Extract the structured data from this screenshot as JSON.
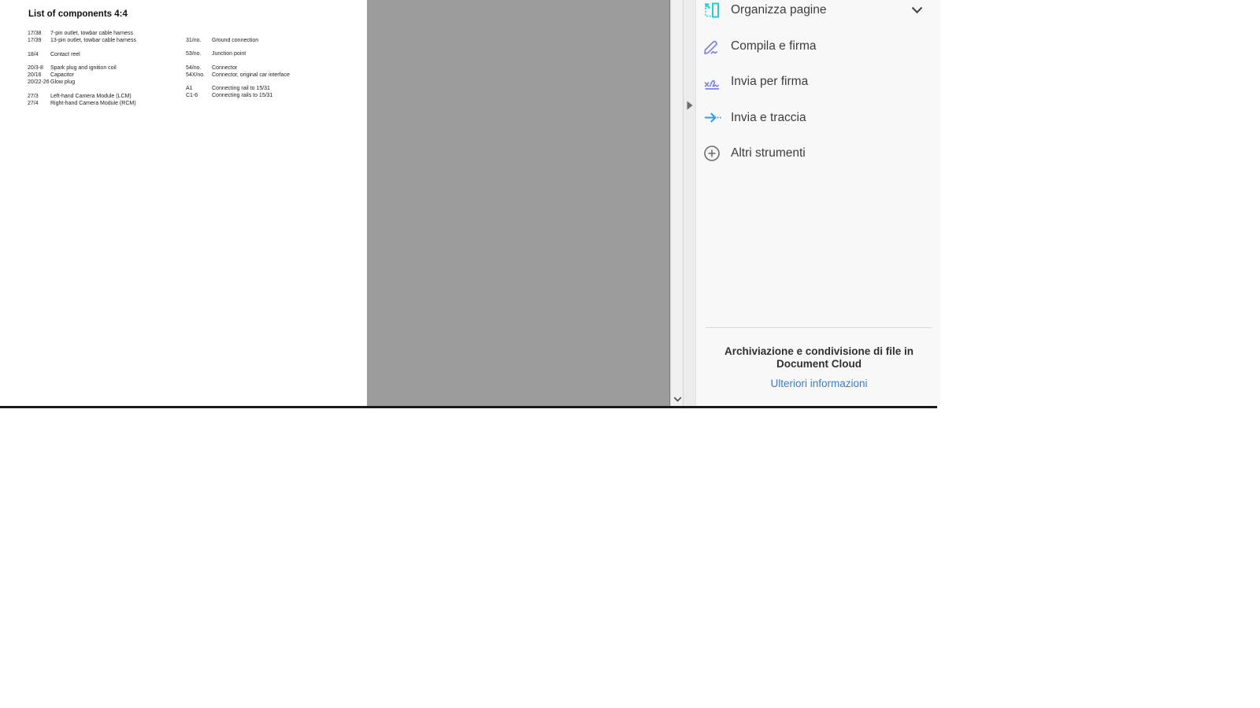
{
  "pdf_page": {
    "title": "List of components 4:4",
    "columns": [
      {
        "groups": [
          [
            {
              "code": "17/38",
              "desc": "7-pin outlet, towbar cable harness"
            },
            {
              "code": "17/39",
              "desc": "13-pin outlet, towbar cable harness"
            }
          ],
          [
            {
              "code": "18/4",
              "desc": "Contact reel"
            }
          ],
          [
            {
              "code": "20/3-8",
              "desc": "Spark plug and ignition coil"
            },
            {
              "code": "20/16",
              "desc": "Capacitor"
            },
            {
              "code": "20/22-26",
              "desc": "Glow plug"
            }
          ],
          [
            {
              "code": "27/3",
              "desc": "Left-hand Camera Module (LCM)"
            },
            {
              "code": "27/4",
              "desc": "Right-hand Camera Module (RCM)"
            }
          ]
        ]
      },
      {
        "groups": [
          [
            {
              "code": "31/no.",
              "desc": "Ground connection"
            }
          ],
          [
            {
              "code": "53/no.",
              "desc": "Junction point"
            }
          ],
          [
            {
              "code": "54/no.",
              "desc": "Connector"
            },
            {
              "code": "54X/no.",
              "desc": "Connector, original car interface"
            }
          ],
          [
            {
              "code": "A1",
              "desc": "Connecting rail to 15/31"
            },
            {
              "code": "C1-6",
              "desc": "Connecting rails to 15/31"
            }
          ]
        ]
      }
    ]
  },
  "tools_panel": {
    "items": [
      {
        "label": "Organizza pagine",
        "icon": "organize-pages-icon",
        "expandable": true
      },
      {
        "label": "Compila e firma",
        "icon": "fill-and-sign-icon",
        "expandable": false
      },
      {
        "label": "Invia per firma",
        "icon": "send-for-signature-icon",
        "expandable": false
      },
      {
        "label": "Invia e traccia",
        "icon": "send-and-track-icon",
        "expandable": false
      },
      {
        "label": "Altri strumenti",
        "icon": "more-tools-icon",
        "expandable": false
      }
    ],
    "promo": {
      "heading_lines": [
        "Archiviazione e condivisione di file in",
        "Document Cloud"
      ],
      "link_label": "Ulteriori informazioni"
    }
  },
  "colors": {
    "viewer_background": "#9c9c9c",
    "panel_background": "#f8f8f8",
    "organize_pages_icon": "#2bc9db",
    "fill_and_sign_icon": "#7d82e8",
    "send_for_signature_icon": "#7d82e8",
    "send_and_track_icon": "#2e9bef",
    "more_tools_icon": "#6f6f6f",
    "link": "#3a7dbf",
    "bottom_line": "#1a1a1a"
  }
}
